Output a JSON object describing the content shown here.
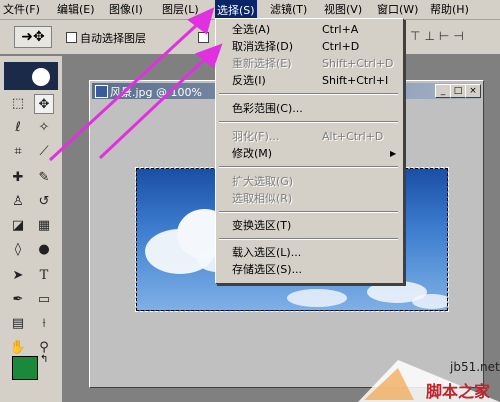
{
  "menubar": {
    "items": [
      {
        "label": "文件(F)"
      },
      {
        "label": "编辑(E)"
      },
      {
        "label": "图像(I)"
      },
      {
        "label": "图层(L)"
      },
      {
        "label": "选择(S)"
      },
      {
        "label": "滤镜(T)"
      },
      {
        "label": "视图(V)"
      },
      {
        "label": "窗口(W)"
      },
      {
        "label": "帮助(H)"
      }
    ]
  },
  "options": {
    "auto_select_label": "自动选择图层"
  },
  "document": {
    "title": "风景.jpg @ 100%"
  },
  "select_menu": {
    "items": [
      {
        "label": "全选(A)",
        "shortcut": "Ctrl+A",
        "enabled": true
      },
      {
        "label": "取消选择(D)",
        "shortcut": "Ctrl+D",
        "enabled": true
      },
      {
        "label": "重新选择(E)",
        "shortcut": "Shift+Ctrl+D",
        "enabled": false
      },
      {
        "label": "反选(I)",
        "shortcut": "Shift+Ctrl+I",
        "enabled": true
      },
      {
        "label": "色彩范围(C)...",
        "shortcut": "",
        "enabled": true
      },
      {
        "label": "羽化(F)...",
        "shortcut": "Alt+Ctrl+D",
        "enabled": false
      },
      {
        "label": "修改(M)",
        "shortcut": "",
        "enabled": true,
        "submenu": true
      },
      {
        "label": "扩大选取(G)",
        "shortcut": "",
        "enabled": false
      },
      {
        "label": "选取相似(R)",
        "shortcut": "",
        "enabled": false
      },
      {
        "label": "变换选区(T)",
        "shortcut": "",
        "enabled": true
      },
      {
        "label": "载入选区(L)...",
        "shortcut": "",
        "enabled": true
      },
      {
        "label": "存储选区(S)...",
        "shortcut": "",
        "enabled": true
      }
    ]
  },
  "watermark": {
    "site": "jb51.net",
    "name": "脚本之家"
  },
  "colors": {
    "highlight": "#0a246a",
    "arrow": "#e030e0",
    "foreground_swatch": "#1a8a3a",
    "background_swatch": "#ffffff"
  }
}
